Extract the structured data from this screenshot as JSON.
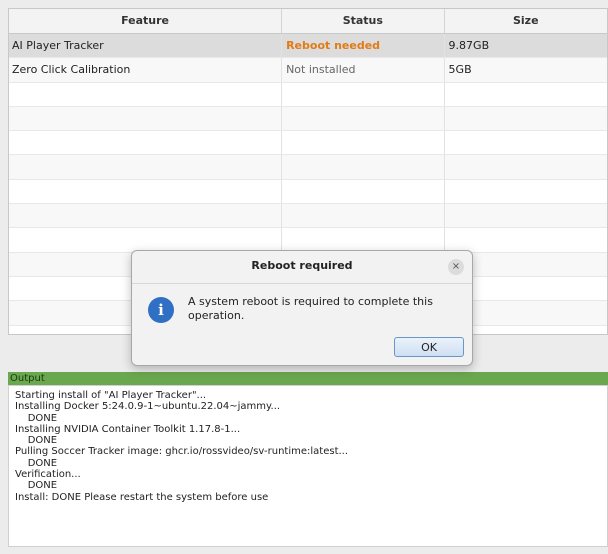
{
  "table": {
    "columns": [
      "Feature",
      "Status",
      "Size"
    ],
    "rows": [
      {
        "feature": "AI Player Tracker",
        "status": "Reboot needed",
        "size": "9.87GB"
      },
      {
        "feature": "Zero Click Calibration",
        "status": "Not installed",
        "size": "5GB"
      }
    ]
  },
  "output": {
    "label": "Output",
    "lines": [
      "Starting install of \"AI Player Tracker\"...",
      "Installing Docker 5:24.0.9-1~ubuntu.22.04~jammy...",
      "    DONE",
      "Installing NVIDIA Container Toolkit 1.17.8-1...",
      "    DONE",
      "Pulling Soccer Tracker image: ghcr.io/rossvideo/sv-runtime:latest...",
      "    DONE",
      "Verification...",
      "    DONE",
      "Install: DONE Please restart the system before use"
    ]
  },
  "dialog": {
    "title": "Reboot required",
    "message": "A system reboot is required to complete this operation.",
    "ok_label": "OK",
    "close_glyph": "×",
    "icon_glyph": "i"
  }
}
